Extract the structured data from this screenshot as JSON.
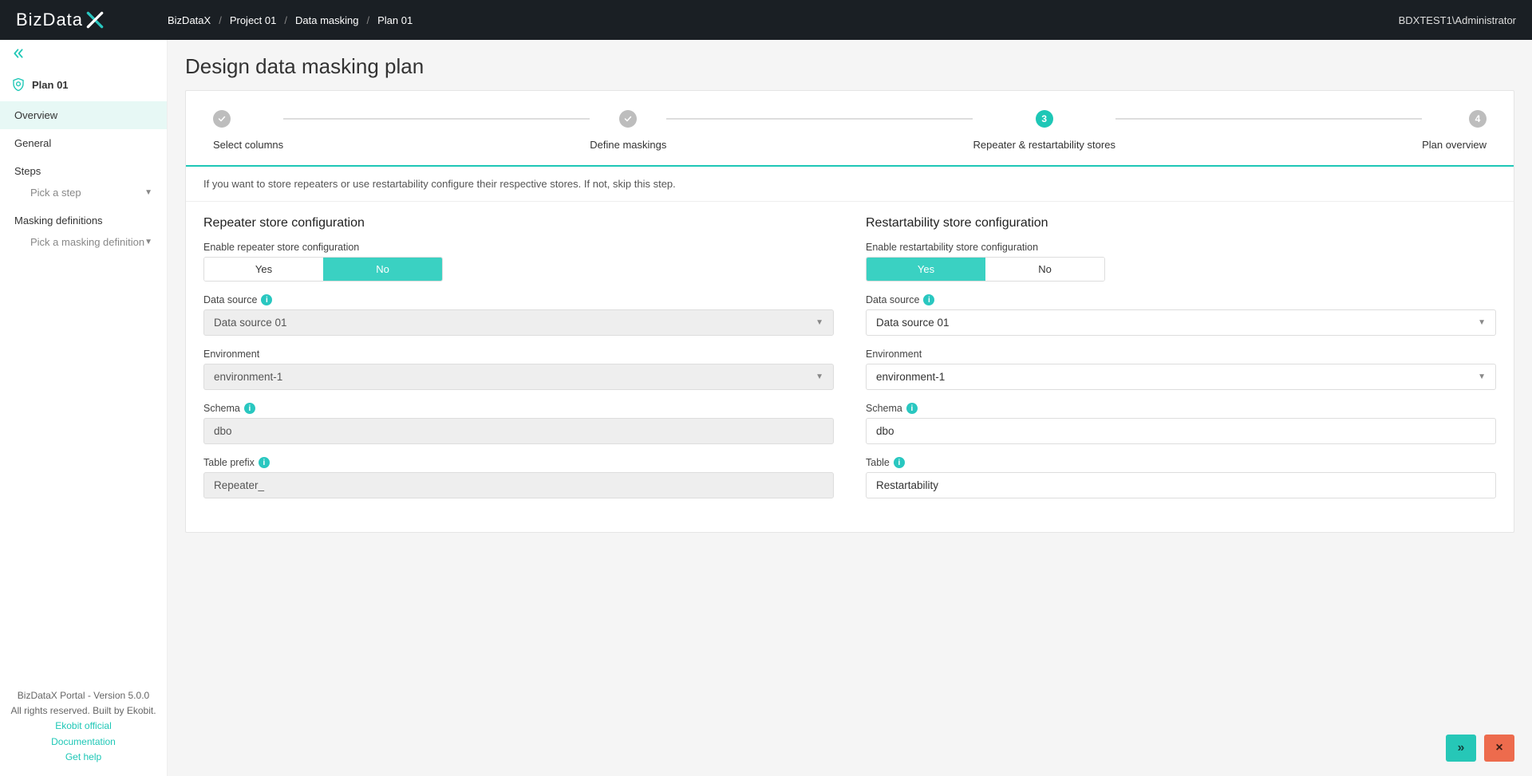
{
  "header": {
    "logo_text": "BizData",
    "breadcrumb": [
      "BizDataX",
      "Project 01",
      "Data masking",
      "Plan 01"
    ],
    "user": "BDXTEST1\\Administrator"
  },
  "sidebar": {
    "plan_name": "Plan 01",
    "nav": {
      "overview": "Overview",
      "general": "General",
      "steps_title": "Steps",
      "steps_placeholder": "Pick a step",
      "masking_title": "Masking definitions",
      "masking_placeholder": "Pick a masking definition"
    },
    "footer": {
      "line1": "BizDataX Portal - Version 5.0.0",
      "line2": "All rights reserved. Built by Ekobit.",
      "links": [
        "Ekobit official",
        "Documentation",
        "Get help"
      ]
    }
  },
  "page": {
    "title": "Design data masking plan",
    "steps": [
      {
        "label": "Select columns",
        "state": "done"
      },
      {
        "label": "Define maskings",
        "state": "done"
      },
      {
        "label": "Repeater & restartability stores",
        "state": "active",
        "num": "3"
      },
      {
        "label": "Plan overview",
        "state": "todo",
        "num": "4"
      }
    ],
    "info": "If you want to store repeaters or use restartability configure their respective stores. If not, skip this step."
  },
  "repeater": {
    "title": "Repeater store configuration",
    "enable_label": "Enable repeater store configuration",
    "yes": "Yes",
    "no": "No",
    "selected": "No",
    "datasource_label": "Data source",
    "datasource_value": "Data source 01",
    "environment_label": "Environment",
    "environment_value": "environment-1",
    "schema_label": "Schema",
    "schema_value": "dbo",
    "prefix_label": "Table prefix",
    "prefix_value": "Repeater_"
  },
  "restart": {
    "title": "Restartability store configuration",
    "enable_label": "Enable restartability store configuration",
    "yes": "Yes",
    "no": "No",
    "selected": "Yes",
    "datasource_label": "Data source",
    "datasource_value": "Data source 01",
    "environment_label": "Environment",
    "environment_value": "environment-1",
    "schema_label": "Schema",
    "schema_value": "dbo",
    "table_label": "Table",
    "table_value": "Restartability"
  },
  "actions": {
    "next": "»",
    "cancel": "×"
  }
}
